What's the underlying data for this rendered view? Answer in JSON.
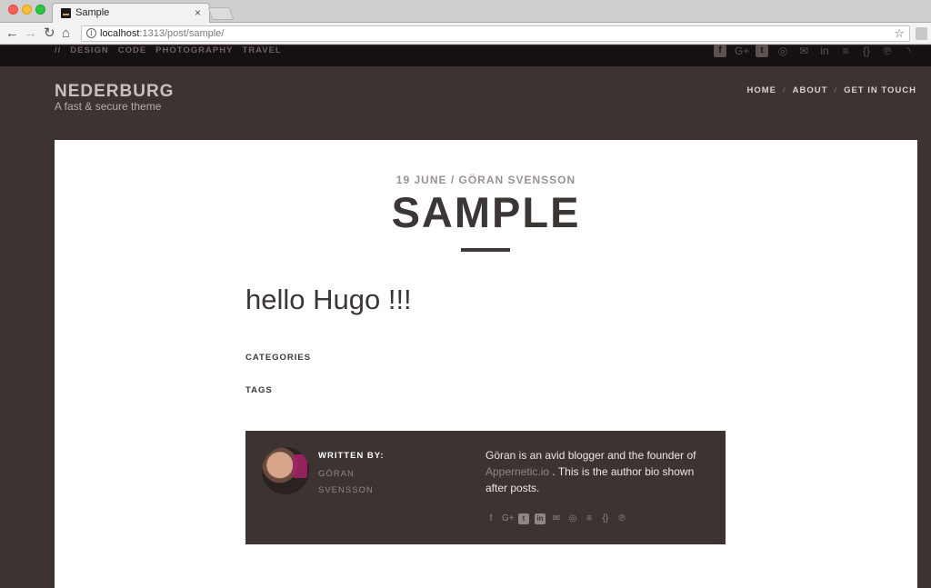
{
  "browser": {
    "tab_title": "Sample",
    "tab_close": "×",
    "url_host": "localhost",
    "url_path": ":1313/post/sample/",
    "nav": {
      "back": "←",
      "forward": "→",
      "reload": "↻",
      "home": "⌂",
      "info": "i",
      "bookmark": "☆"
    }
  },
  "topbar": {
    "categories": [
      "//",
      "DESIGN",
      "CODE",
      "PHOTOGRAPHY",
      "TRAVEL"
    ],
    "social_icons": [
      "facebook-icon",
      "google-plus-icon",
      "twitter-icon",
      "instagram-icon",
      "email-icon",
      "linkedin-icon",
      "stackoverflow-icon",
      "github-icon",
      "pinterest-icon",
      "rss-icon"
    ]
  },
  "header": {
    "site_name": "NEDERBURG",
    "tagline": "A fast & secure theme",
    "nav": [
      "HOME",
      "ABOUT",
      "GET IN TOUCH"
    ],
    "separator": "/"
  },
  "post": {
    "meta": "19 JUNE / GÖRAN SVENSSON",
    "title": "SAMPLE",
    "content_heading": "hello Hugo !!!",
    "categories_label": "CATEGORIES",
    "tags_label": "TAGS"
  },
  "author": {
    "written_by": "WRITTEN BY:",
    "name": "GÖRAN SVENSSON",
    "bio_before": "Göran is an avid blogger and the founder of ",
    "bio_link": "Appernetic.io",
    "bio_after": " . This is the author bio shown after posts.",
    "social_icons": [
      "facebook-icon",
      "google-plus-icon",
      "twitter-icon",
      "linkedin-icon",
      "email-icon",
      "instagram-icon",
      "stackoverflow-icon",
      "github-icon",
      "pinterest-icon"
    ]
  }
}
